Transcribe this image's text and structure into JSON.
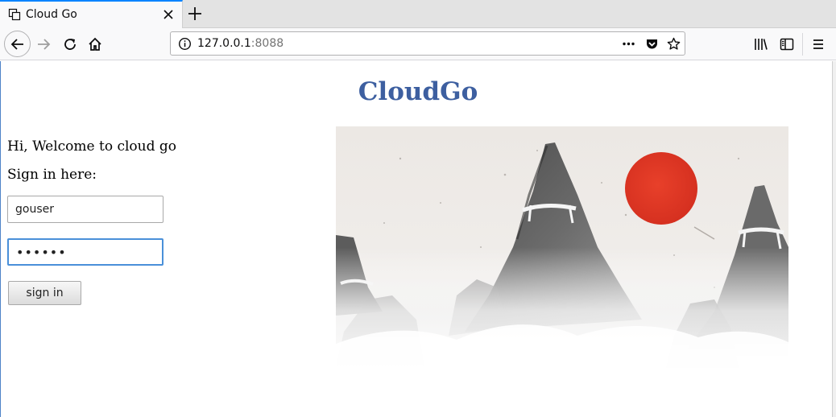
{
  "browser": {
    "tab_title": "Cloud Go",
    "url_host": "127.0.0.1",
    "url_port": ":8088",
    "icons": {
      "favicon": "tab-pages-icon",
      "close": "close-icon",
      "new_tab": "plus-icon",
      "back": "back-arrow-icon",
      "forward": "forward-arrow-icon",
      "reload": "reload-icon",
      "home": "home-icon",
      "info": "info-icon",
      "page_actions": "more-dots-icon",
      "pocket": "pocket-icon",
      "bookmark": "star-icon",
      "library": "library-icon",
      "sidebar": "sidebar-icon",
      "menu": "hamburger-menu-icon"
    }
  },
  "page": {
    "title": "CloudGo",
    "welcome": "Hi, Welcome to cloud go",
    "signin_prompt": "Sign in here:",
    "username_value": "gouser",
    "password_value": "••••••",
    "signin_label": "sign in",
    "hero_image": "ink-mountains-red-sun-image",
    "colors": {
      "title": "#3d5fa0",
      "sun": "#e23a26",
      "focus_border": "#4a90d9"
    }
  }
}
